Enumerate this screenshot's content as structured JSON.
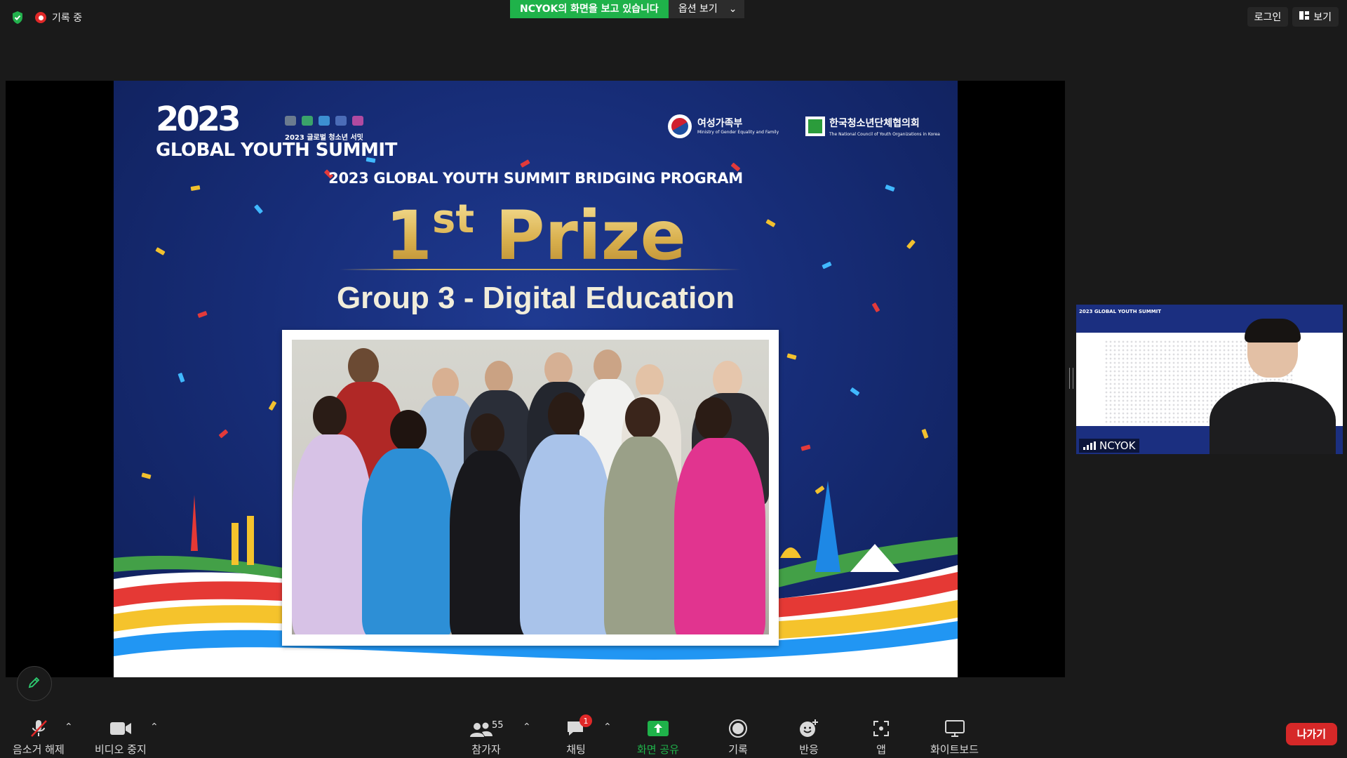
{
  "top": {
    "recording_label": "기록 중",
    "share_status": "NCYOK의 화면을 보고 있습니다",
    "view_options": "옵션 보기",
    "login": "로그인",
    "view": "보기"
  },
  "slide": {
    "logo_year": "2023",
    "logo_korean": "2023 글로벌 청소년 서밋",
    "logo_title": "GLOBAL YOUTH SUMMIT",
    "ministry_name": "여성가족부",
    "ministry_en": "Ministry of Gender Equality and Family",
    "council_name": "한국청소년단체협의회",
    "council_en": "The National Council of Youth Organizations in Korea",
    "program": "2023 GLOBAL YOUTH SUMMIT BRIDGING PROGRAM",
    "prize_num": "1",
    "prize_sup": "st",
    "prize_word": "Prize",
    "group": "Group 3 - Digital Education"
  },
  "webcam": {
    "name": "NCYOK",
    "header_logo": "2023 GLOBAL YOUTH SUMMIT"
  },
  "toolbar": {
    "mute": "음소거 해제",
    "video": "비디오 중지",
    "participants": "참가자",
    "participants_count": "55",
    "chat": "채팅",
    "chat_badge": "1",
    "share": "화면 공유",
    "record": "기록",
    "reactions": "반응",
    "apps": "앱",
    "whiteboard": "화이트보드",
    "leave": "나가기"
  },
  "colors": {
    "accent_green": "#1fb24a",
    "leave_red": "#d62828",
    "slide_blue": "#172d78",
    "gold": "#d9b04e"
  }
}
